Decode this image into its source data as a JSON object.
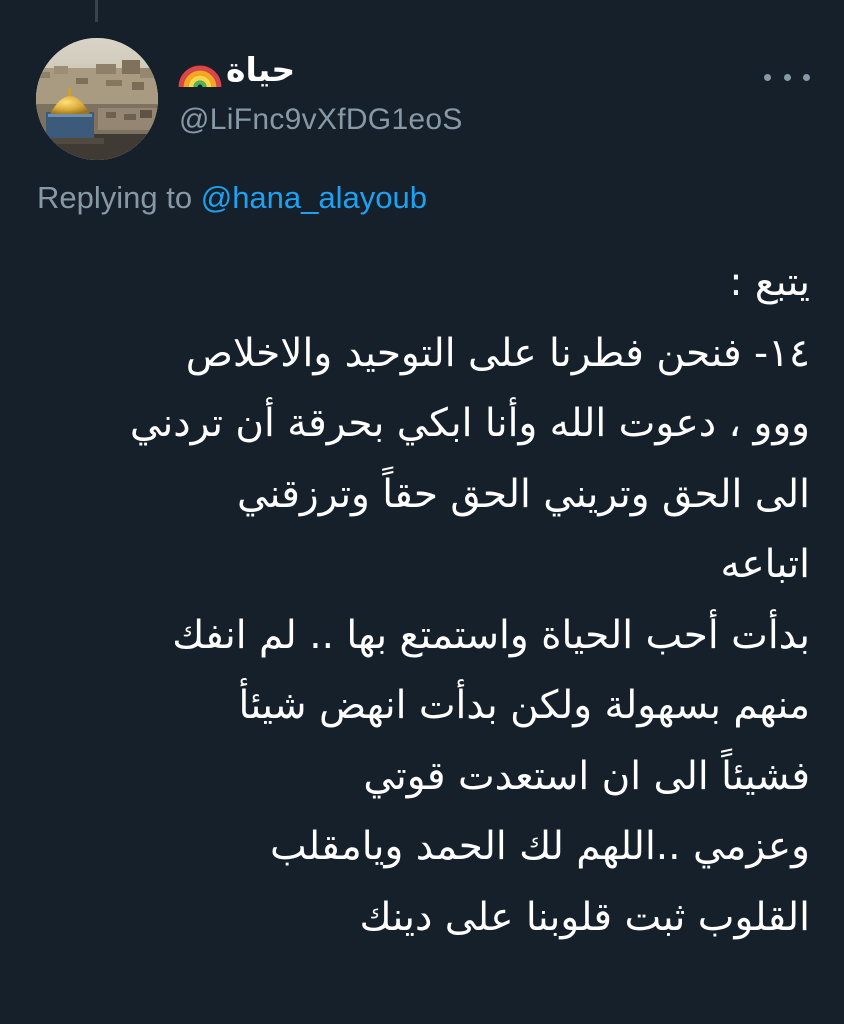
{
  "tweet": {
    "author": {
      "display_name": "حياة",
      "name_emoji": "rainbow-icon",
      "handle": "@LiFnc9vXfDG1eoS",
      "avatar": "dome-of-the-rock-photo"
    },
    "reply": {
      "prefix": "Replying to",
      "handle": "@hana_alayoub"
    },
    "more_icon": "more-icon",
    "lines": [
      "يتبع :",
      "١٤- فنحن فطرنا على التوحيد والاخلاص",
      "ووو ، دعوت الله وأنا ابكي بحرقة أن تردني",
      "الى الحق وتريني الحق حقاً وترزقني",
      "اتباعه",
      "بدأت أحب الحياة واستمتع بها .. لم انفك",
      "منهم بسهولة ولكن بدأت انهض شيئأ",
      "فشيئاً الى ان استعدت قوتي",
      "وعزمي ..اللهم لك الحمد ويامقلب",
      "القلوب ثبت قلوبنا على دينك"
    ]
  },
  "colors": {
    "background": "#15202b",
    "text_primary": "#ffffff",
    "text_secondary": "#8899a6",
    "link": "#1da1f2",
    "thread_line": "#38444d"
  }
}
